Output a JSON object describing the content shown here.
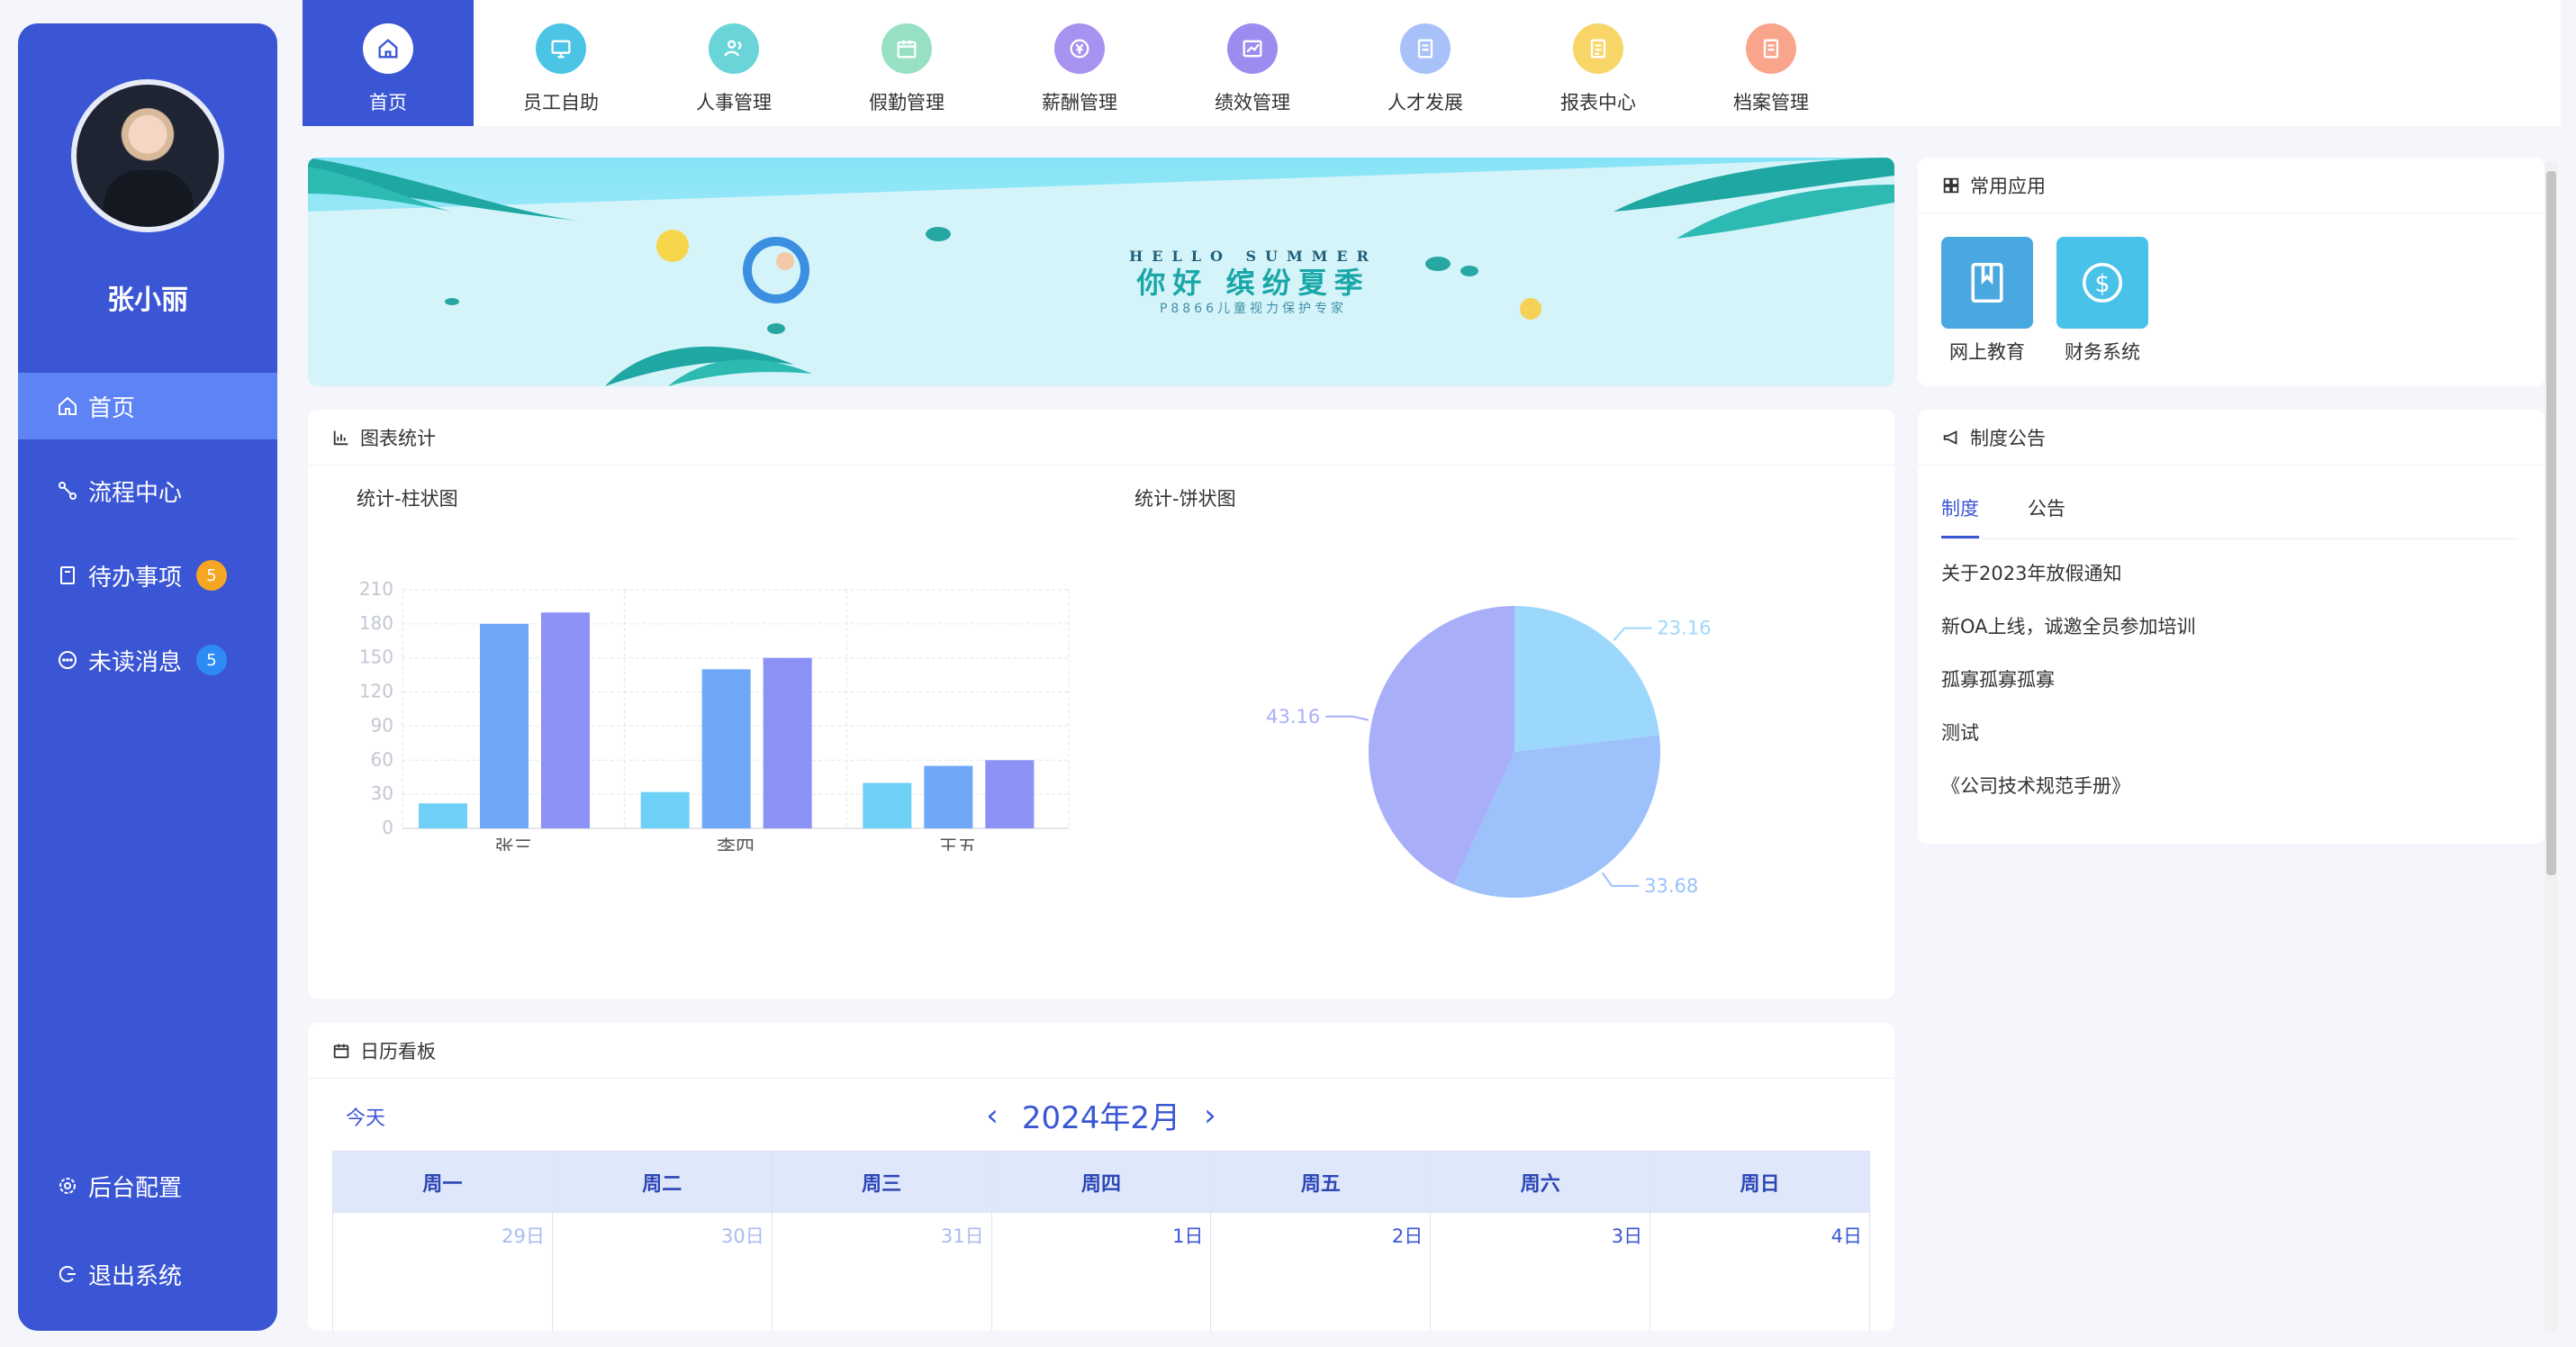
{
  "user": {
    "name": "张小丽"
  },
  "sidebar": {
    "items": [
      {
        "label": "首页",
        "icon": "home-icon",
        "active": true
      },
      {
        "label": "流程中心",
        "icon": "flow-icon"
      },
      {
        "label": "待办事项",
        "icon": "todo-icon",
        "badge": "5"
      },
      {
        "label": "未读消息",
        "icon": "message-icon",
        "badge": "5"
      },
      {
        "label": "后台配置",
        "icon": "gear-icon"
      },
      {
        "label": "退出系统",
        "icon": "logout-icon"
      }
    ]
  },
  "topnav": {
    "items": [
      {
        "label": "首页",
        "icon": "home-icon",
        "color": "#ffffff",
        "active": true
      },
      {
        "label": "员工自助",
        "icon": "monitor-icon",
        "color": "#4cc4e6"
      },
      {
        "label": "人事管理",
        "icon": "people-icon",
        "color": "#6ad5d9"
      },
      {
        "label": "假勤管理",
        "icon": "calendar-icon",
        "color": "#97e0c4"
      },
      {
        "label": "薪酬管理",
        "icon": "yen-icon",
        "color": "#a792ef"
      },
      {
        "label": "绩效管理",
        "icon": "chart-icon",
        "color": "#9d8cf0"
      },
      {
        "label": "人才发展",
        "icon": "doc-icon",
        "color": "#a9c1f9"
      },
      {
        "label": "报表中心",
        "icon": "report-icon",
        "color": "#f7d667"
      },
      {
        "label": "档案管理",
        "icon": "archive-icon",
        "color": "#f8a58c"
      }
    ]
  },
  "banner": {
    "line1": "HELLO SUMMER",
    "line2": "你好  缤纷夏季",
    "line3": "P8866儿童视力保护专家"
  },
  "charts_panel": {
    "title": "图表统计",
    "bar_title": "统计-柱状图",
    "pie_title": "统计-饼状图"
  },
  "chart_data": [
    {
      "type": "bar",
      "categories": [
        "张三",
        "李四",
        "王五"
      ],
      "series": [
        {
          "values": [
            22,
            32,
            40
          ],
          "color": "#6fd0f7"
        },
        {
          "values": [
            180,
            140,
            55
          ],
          "color": "#6ea8f7"
        },
        {
          "values": [
            190,
            150,
            60
          ],
          "color": "#8c91f6"
        }
      ],
      "ylim": [
        0,
        210
      ],
      "yticks": [
        0,
        30,
        60,
        90,
        120,
        150,
        180,
        210
      ],
      "grid": true
    },
    {
      "type": "pie",
      "slices": [
        {
          "label": "23.16",
          "value": 23.16,
          "color": "#9cd8fb"
        },
        {
          "label": "33.68",
          "value": 33.68,
          "color": "#9cc1fb"
        },
        {
          "label": "43.16",
          "value": 43.16,
          "color": "#a9aef8"
        }
      ]
    }
  ],
  "apps_panel": {
    "title": "常用应用",
    "apps": [
      {
        "label": "网上教育",
        "icon": "book-icon",
        "color": "#4aa8e0"
      },
      {
        "label": "财务系统",
        "icon": "dollar-icon",
        "color": "#49c2ea"
      }
    ]
  },
  "notice_panel": {
    "title": "制度公告",
    "tabs": [
      {
        "label": "制度",
        "active": true
      },
      {
        "label": "公告"
      }
    ],
    "items": [
      "关于2023年放假通知",
      "新OA上线，诚邀全员参加培训",
      "孤寡孤寡孤寡",
      "测试",
      "《公司技术规范手册》"
    ]
  },
  "calendar": {
    "title": "日历看板",
    "today_label": "今天",
    "month_label": "2024年2月",
    "weekdays": [
      "周一",
      "周二",
      "周三",
      "周四",
      "周五",
      "周六",
      "周日"
    ],
    "days": [
      {
        "label": "29日",
        "muted": true
      },
      {
        "label": "30日",
        "muted": true
      },
      {
        "label": "31日",
        "muted": true
      },
      {
        "label": "1日"
      },
      {
        "label": "2日"
      },
      {
        "label": "3日"
      },
      {
        "label": "4日"
      }
    ]
  }
}
